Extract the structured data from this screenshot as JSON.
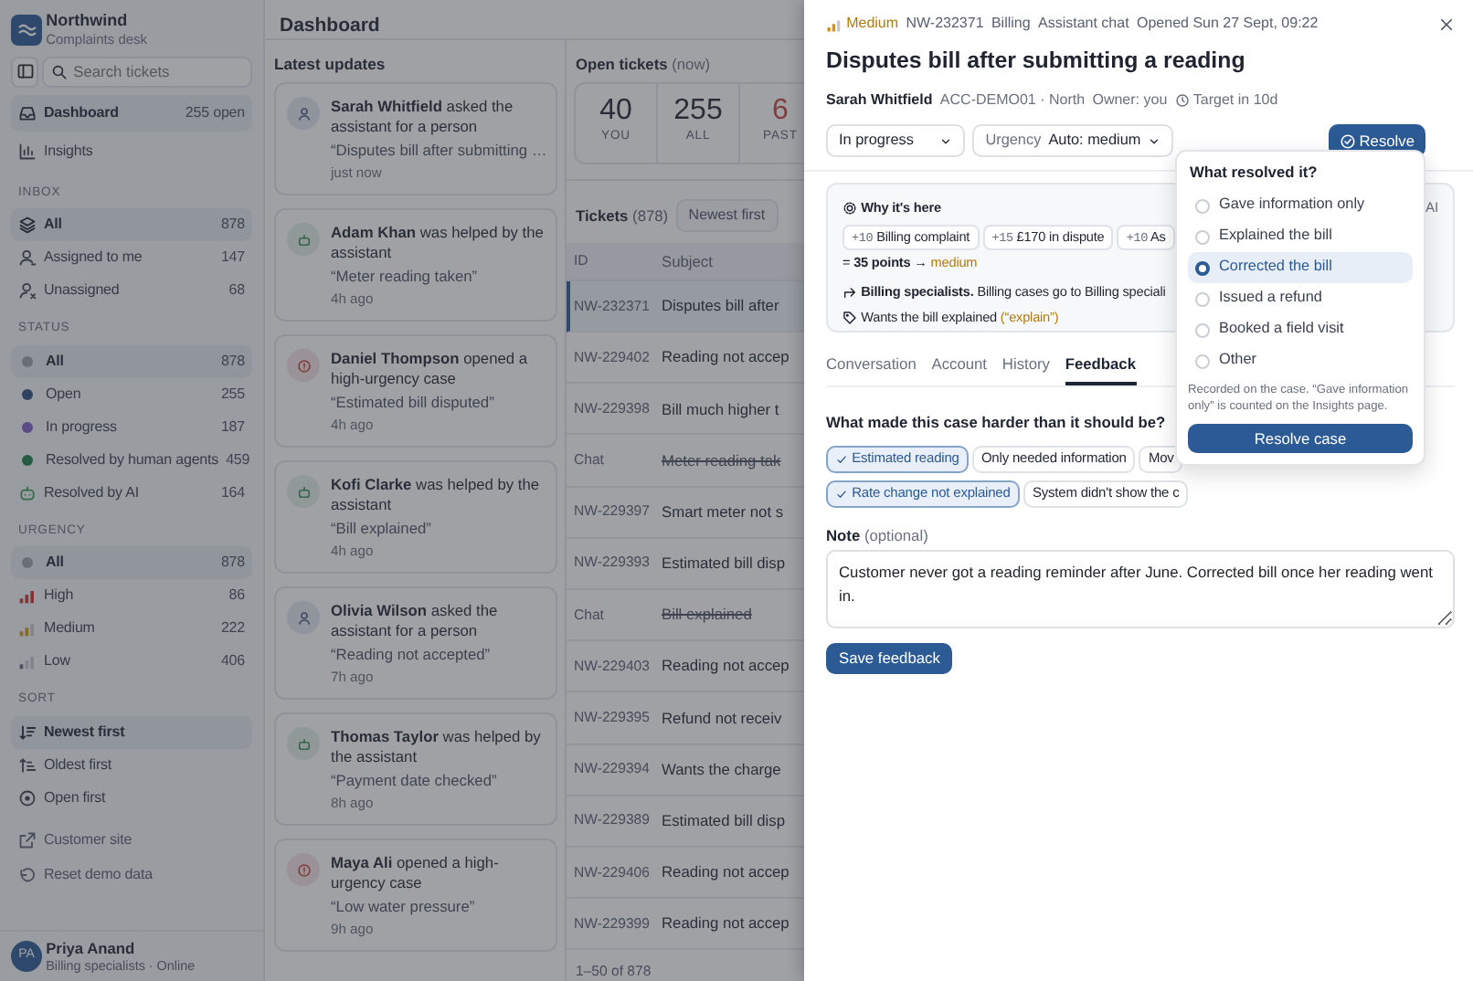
{
  "sidebar": {
    "brand": {
      "name": "Northwind",
      "subtitle": "Complaints desk"
    },
    "search": {
      "placeholder": "Search tickets"
    },
    "nav": [
      {
        "label": "Dashboard",
        "count": "255 open",
        "selected": true
      },
      {
        "label": "Insights",
        "selected": false
      }
    ],
    "sections": [
      {
        "heading": "INBOX",
        "items": [
          {
            "label": "All",
            "count": "878",
            "selected": true
          },
          {
            "label": "Assigned to me",
            "count": "147",
            "selected": false
          },
          {
            "label": "Unassigned",
            "count": "68",
            "selected": false
          }
        ]
      },
      {
        "heading": "STATUS",
        "items": [
          {
            "label": "All",
            "count": "878",
            "kind": "dot",
            "color": "#6a6f77",
            "selected": true
          },
          {
            "label": "Open",
            "count": "255",
            "kind": "dot",
            "color": "#304260",
            "selected": false
          },
          {
            "label": "In progress",
            "count": "187",
            "kind": "dot",
            "color": "#5a4b86",
            "selected": false
          },
          {
            "label": "Resolved by human agents",
            "count": "459",
            "kind": "dot",
            "color": "#285b43",
            "selected": false
          },
          {
            "label": "Resolved by AI",
            "count": "164",
            "kind": "bot",
            "color": "#3a6c4f",
            "selected": false
          }
        ]
      },
      {
        "heading": "URGENCY",
        "items": [
          {
            "label": "All",
            "count": "878",
            "kind": "dot",
            "color": "#6a6f77",
            "selected": true
          },
          {
            "label": "High",
            "count": "86",
            "kind": "high",
            "selected": false
          },
          {
            "label": "Medium",
            "count": "222",
            "kind": "medium",
            "selected": false
          },
          {
            "label": "Low",
            "count": "406",
            "kind": "low",
            "selected": false
          }
        ]
      },
      {
        "heading": "SORT",
        "items": [
          {
            "label": "Newest first",
            "selected": true
          },
          {
            "label": "Oldest first",
            "selected": false
          },
          {
            "label": "Open first",
            "selected": false
          }
        ]
      }
    ],
    "links": [
      {
        "label": "Customer site"
      },
      {
        "label": "Reset demo data"
      }
    ],
    "user": {
      "initials": "PA",
      "name": "Priya Anand",
      "subtitle": "Billing specialists · Online"
    }
  },
  "page_title": "Dashboard",
  "feed": {
    "title": "Latest updates",
    "items": [
      {
        "kind": "person",
        "name": "Sarah Whitfield",
        "action": "asked the assistant for a person",
        "quote": "“Disputes bill after submitting …",
        "time": "just now"
      },
      {
        "kind": "assistant",
        "name": "Adam Khan",
        "action": "was helped by the assistant",
        "quote": "“Meter reading taken”",
        "time": "4h ago"
      },
      {
        "kind": "urgent",
        "name": "Daniel Thompson",
        "action": "opened a high-urgency case",
        "quote": "“Estimated bill disputed”",
        "time": "4h ago"
      },
      {
        "kind": "assistant",
        "name": "Kofi Clarke",
        "action": "was helped by the assistant",
        "quote": "“Bill explained”",
        "time": "4h ago"
      },
      {
        "kind": "person",
        "name": "Olivia Wilson",
        "action": "asked the assistant for a person",
        "quote": "“Reading not accepted”",
        "time": "7h ago"
      },
      {
        "kind": "assistant",
        "name": "Thomas Taylor",
        "action": "was helped by the assistant",
        "quote": "“Payment date checked”",
        "time": "8h ago"
      },
      {
        "kind": "urgent",
        "name": "Maya Ali",
        "action": "opened a high-urgency case",
        "quote": "“Low water pressure”",
        "time": "9h ago"
      }
    ]
  },
  "open_tickets": {
    "title": "Open tickets",
    "suffix": "(now)",
    "stats": [
      {
        "value": "40",
        "label": "YOU",
        "kind": "normal"
      },
      {
        "value": "255",
        "label": "ALL",
        "kind": "normal"
      },
      {
        "value": "6",
        "label": "PAST",
        "kind": "alert"
      }
    ]
  },
  "tickets": {
    "title": "Tickets",
    "count": "(878)",
    "sort": "Newest first",
    "columns": [
      "ID",
      "Subject"
    ],
    "rows": [
      {
        "id": "NW-232371",
        "subject": "Disputes bill after",
        "kind": "ticket",
        "selected": true
      },
      {
        "id": "NW-229402",
        "subject": "Reading not accep",
        "kind": "ticket",
        "selected": false
      },
      {
        "id": "NW-229398",
        "subject": "Bill much higher t",
        "kind": "ticket",
        "selected": false
      },
      {
        "id": "Chat",
        "subject": "Meter reading tak",
        "kind": "chat",
        "selected": false
      },
      {
        "id": "NW-229397",
        "subject": "Smart meter not s",
        "kind": "ticket",
        "selected": false
      },
      {
        "id": "NW-229393",
        "subject": "Estimated bill disp",
        "kind": "ticket",
        "selected": false
      },
      {
        "id": "Chat",
        "subject": "Bill explained",
        "kind": "chat",
        "selected": false
      },
      {
        "id": "NW-229403",
        "subject": "Reading not accep",
        "kind": "ticket",
        "selected": false
      },
      {
        "id": "NW-229395",
        "subject": "Refund not receiv",
        "kind": "ticket",
        "selected": false
      },
      {
        "id": "NW-229394",
        "subject": "Wants the charge",
        "kind": "ticket",
        "selected": false
      },
      {
        "id": "NW-229389",
        "subject": "Estimated bill disp",
        "kind": "ticket",
        "selected": false
      },
      {
        "id": "NW-229406",
        "subject": "Reading not accep",
        "kind": "ticket",
        "selected": false
      },
      {
        "id": "NW-229399",
        "subject": "Reading not accep",
        "kind": "ticket",
        "selected": false
      }
    ],
    "footer": "1–50 of 878"
  },
  "drawer": {
    "urgency": "Medium",
    "meta": [
      "NW-232371",
      "Billing",
      "Assistant chat",
      "Opened Sun 27 Sept, 09:22"
    ],
    "title": "Disputes bill after submitting a reading",
    "customer": "Sarah Whitfield",
    "account": "ACC-DEMO01 · North",
    "owner": "Owner: you",
    "target": "Target in 10d",
    "status_select": "In progress",
    "urgency_select": {
      "label": "Urgency",
      "value": "Auto: medium"
    },
    "resolve_button": "Resolve",
    "why": {
      "title": "Why it's here",
      "badge": "AI",
      "chips": [
        {
          "points": "+10",
          "label": "Billing complaint"
        },
        {
          "points": "+15",
          "label": "£170 in dispute"
        },
        {
          "points": "+10",
          "label": "As"
        }
      ],
      "total": "= **35 points** →",
      "total_level": "medium",
      "routing": "**Billing specialists.** Billing cases go to Billing speciali",
      "intent": "Wants the bill explained",
      "intent_code": "(“explain”)"
    },
    "tabs": [
      {
        "label": "Conversation",
        "selected": false
      },
      {
        "label": "Account",
        "selected": false
      },
      {
        "label": "History",
        "selected": false
      },
      {
        "label": "Feedback",
        "selected": true
      }
    ],
    "feedback": {
      "question": "What made this case harder than it should be?",
      "rows": [
        [
          {
            "label": "Estimated reading",
            "selected": true
          },
          {
            "label": "Only needed information",
            "selected": false
          },
          {
            "label": "Mov",
            "selected": false
          }
        ],
        [
          {
            "label": "Rate change not explained",
            "selected": true
          },
          {
            "label": "System didn't show the c",
            "selected": false
          }
        ]
      ],
      "note_label": "Note",
      "note_hint": "(optional)",
      "note_value": "Customer never got a reading reminder after June. Corrected bill once her reading went in.",
      "save": "Save feedback"
    },
    "resolve_popover": {
      "title": "What resolved it?",
      "options": [
        {
          "label": "Gave information only",
          "selected": false
        },
        {
          "label": "Explained the bill",
          "selected": false
        },
        {
          "label": "Corrected the bill",
          "selected": true
        },
        {
          "label": "Issued a refund",
          "selected": false
        },
        {
          "label": "Booked a field visit",
          "selected": false
        },
        {
          "label": "Other",
          "selected": false
        }
      ],
      "note": "Recorded on the case. “Gave information only” is counted on the Insights page.",
      "button": "Resolve case"
    }
  }
}
